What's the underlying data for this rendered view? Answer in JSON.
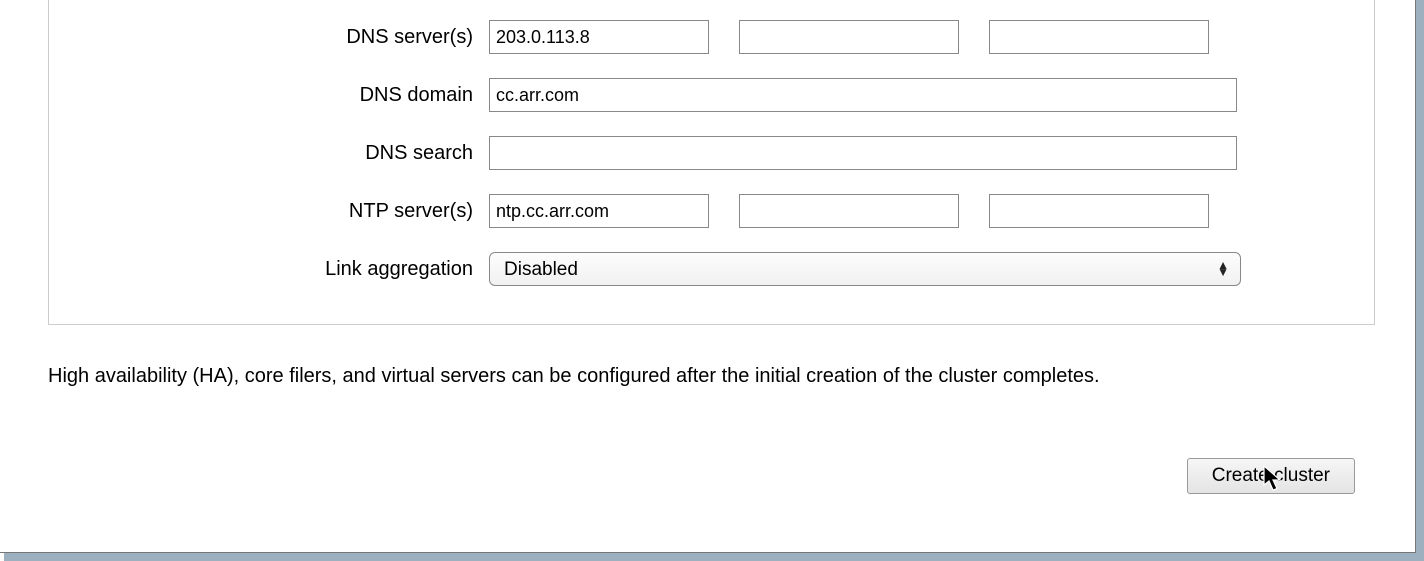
{
  "form": {
    "dns_servers": {
      "label": "DNS server(s)",
      "values": [
        "203.0.113.8",
        "",
        ""
      ]
    },
    "dns_domain": {
      "label": "DNS domain",
      "value": "cc.arr.com"
    },
    "dns_search": {
      "label": "DNS search",
      "value": ""
    },
    "ntp_servers": {
      "label": "NTP server(s)",
      "values": [
        "ntp.cc.arr.com",
        "",
        ""
      ]
    },
    "link_aggregation": {
      "label": "Link aggregation",
      "selected": "Disabled"
    }
  },
  "note_text": "High availability (HA), core filers, and virtual servers can be configured after the initial creation of the cluster completes.",
  "buttons": {
    "create": "Create cluster"
  }
}
